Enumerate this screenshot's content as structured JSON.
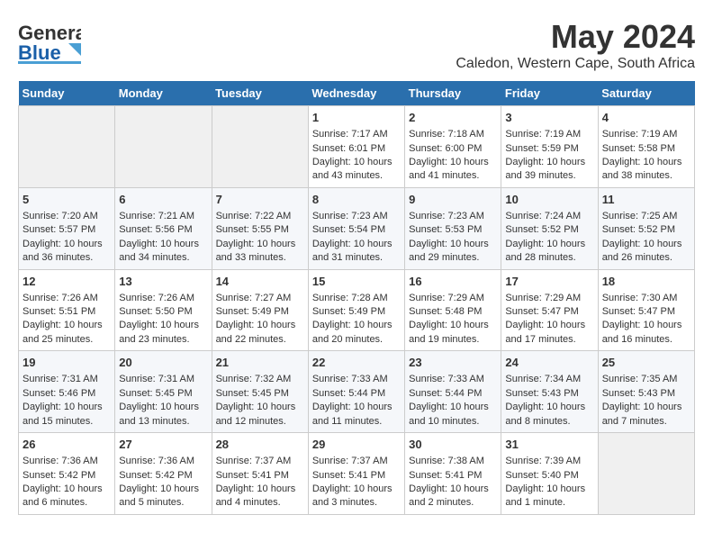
{
  "header": {
    "logo_line1": "General",
    "logo_line2": "Blue",
    "month_year": "May 2024",
    "location": "Caledon, Western Cape, South Africa"
  },
  "weekdays": [
    "Sunday",
    "Monday",
    "Tuesday",
    "Wednesday",
    "Thursday",
    "Friday",
    "Saturday"
  ],
  "weeks": [
    [
      {
        "day": "",
        "empty": true
      },
      {
        "day": "",
        "empty": true
      },
      {
        "day": "",
        "empty": true
      },
      {
        "day": "1",
        "sunrise": "7:17 AM",
        "sunset": "6:01 PM",
        "daylight": "10 hours and 43 minutes."
      },
      {
        "day": "2",
        "sunrise": "7:18 AM",
        "sunset": "6:00 PM",
        "daylight": "10 hours and 41 minutes."
      },
      {
        "day": "3",
        "sunrise": "7:19 AM",
        "sunset": "5:59 PM",
        "daylight": "10 hours and 39 minutes."
      },
      {
        "day": "4",
        "sunrise": "7:19 AM",
        "sunset": "5:58 PM",
        "daylight": "10 hours and 38 minutes."
      }
    ],
    [
      {
        "day": "5",
        "sunrise": "7:20 AM",
        "sunset": "5:57 PM",
        "daylight": "10 hours and 36 minutes."
      },
      {
        "day": "6",
        "sunrise": "7:21 AM",
        "sunset": "5:56 PM",
        "daylight": "10 hours and 34 minutes."
      },
      {
        "day": "7",
        "sunrise": "7:22 AM",
        "sunset": "5:55 PM",
        "daylight": "10 hours and 33 minutes."
      },
      {
        "day": "8",
        "sunrise": "7:23 AM",
        "sunset": "5:54 PM",
        "daylight": "10 hours and 31 minutes."
      },
      {
        "day": "9",
        "sunrise": "7:23 AM",
        "sunset": "5:53 PM",
        "daylight": "10 hours and 29 minutes."
      },
      {
        "day": "10",
        "sunrise": "7:24 AM",
        "sunset": "5:52 PM",
        "daylight": "10 hours and 28 minutes."
      },
      {
        "day": "11",
        "sunrise": "7:25 AM",
        "sunset": "5:52 PM",
        "daylight": "10 hours and 26 minutes."
      }
    ],
    [
      {
        "day": "12",
        "sunrise": "7:26 AM",
        "sunset": "5:51 PM",
        "daylight": "10 hours and 25 minutes."
      },
      {
        "day": "13",
        "sunrise": "7:26 AM",
        "sunset": "5:50 PM",
        "daylight": "10 hours and 23 minutes."
      },
      {
        "day": "14",
        "sunrise": "7:27 AM",
        "sunset": "5:49 PM",
        "daylight": "10 hours and 22 minutes."
      },
      {
        "day": "15",
        "sunrise": "7:28 AM",
        "sunset": "5:49 PM",
        "daylight": "10 hours and 20 minutes."
      },
      {
        "day": "16",
        "sunrise": "7:29 AM",
        "sunset": "5:48 PM",
        "daylight": "10 hours and 19 minutes."
      },
      {
        "day": "17",
        "sunrise": "7:29 AM",
        "sunset": "5:47 PM",
        "daylight": "10 hours and 17 minutes."
      },
      {
        "day": "18",
        "sunrise": "7:30 AM",
        "sunset": "5:47 PM",
        "daylight": "10 hours and 16 minutes."
      }
    ],
    [
      {
        "day": "19",
        "sunrise": "7:31 AM",
        "sunset": "5:46 PM",
        "daylight": "10 hours and 15 minutes."
      },
      {
        "day": "20",
        "sunrise": "7:31 AM",
        "sunset": "5:45 PM",
        "daylight": "10 hours and 13 minutes."
      },
      {
        "day": "21",
        "sunrise": "7:32 AM",
        "sunset": "5:45 PM",
        "daylight": "10 hours and 12 minutes."
      },
      {
        "day": "22",
        "sunrise": "7:33 AM",
        "sunset": "5:44 PM",
        "daylight": "10 hours and 11 minutes."
      },
      {
        "day": "23",
        "sunrise": "7:33 AM",
        "sunset": "5:44 PM",
        "daylight": "10 hours and 10 minutes."
      },
      {
        "day": "24",
        "sunrise": "7:34 AM",
        "sunset": "5:43 PM",
        "daylight": "10 hours and 8 minutes."
      },
      {
        "day": "25",
        "sunrise": "7:35 AM",
        "sunset": "5:43 PM",
        "daylight": "10 hours and 7 minutes."
      }
    ],
    [
      {
        "day": "26",
        "sunrise": "7:36 AM",
        "sunset": "5:42 PM",
        "daylight": "10 hours and 6 minutes."
      },
      {
        "day": "27",
        "sunrise": "7:36 AM",
        "sunset": "5:42 PM",
        "daylight": "10 hours and 5 minutes."
      },
      {
        "day": "28",
        "sunrise": "7:37 AM",
        "sunset": "5:41 PM",
        "daylight": "10 hours and 4 minutes."
      },
      {
        "day": "29",
        "sunrise": "7:37 AM",
        "sunset": "5:41 PM",
        "daylight": "10 hours and 3 minutes."
      },
      {
        "day": "30",
        "sunrise": "7:38 AM",
        "sunset": "5:41 PM",
        "daylight": "10 hours and 2 minutes."
      },
      {
        "day": "31",
        "sunrise": "7:39 AM",
        "sunset": "5:40 PM",
        "daylight": "10 hours and 1 minute."
      },
      {
        "day": "",
        "empty": true
      }
    ]
  ],
  "labels": {
    "sunrise": "Sunrise:",
    "sunset": "Sunset:",
    "daylight": "Daylight:"
  }
}
